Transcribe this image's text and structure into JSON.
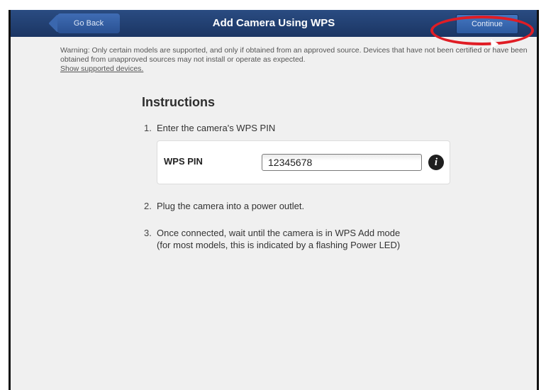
{
  "header": {
    "back_label": "Go Back",
    "title": "Add Camera Using WPS",
    "continue_label": "Continue"
  },
  "warning": {
    "text": "Warning: Only certain models are supported, and only if obtained from an approved source. Devices that have not been certified or have been obtained from unapproved sources may not install or operate as expected.",
    "link": "Show supported devices."
  },
  "instructions": {
    "heading": "Instructions",
    "steps": [
      {
        "num": "1.",
        "text": "Enter the camera's WPS PIN"
      },
      {
        "num": "2.",
        "text": "Plug the camera into a power outlet."
      },
      {
        "num": "3.",
        "text": "Once connected, wait until the camera is in WPS Add mode",
        "text2": "(for most models, this is indicated by a flashing Power LED)"
      }
    ]
  },
  "pin": {
    "label": "WPS PIN",
    "value": "12345678"
  },
  "icons": {
    "info": "info-icon",
    "cursor": "mouse-cursor"
  },
  "colors": {
    "header_bg": "#1b3563",
    "button_blue": "#2d5aa0",
    "highlight_red": "#e01d25"
  }
}
